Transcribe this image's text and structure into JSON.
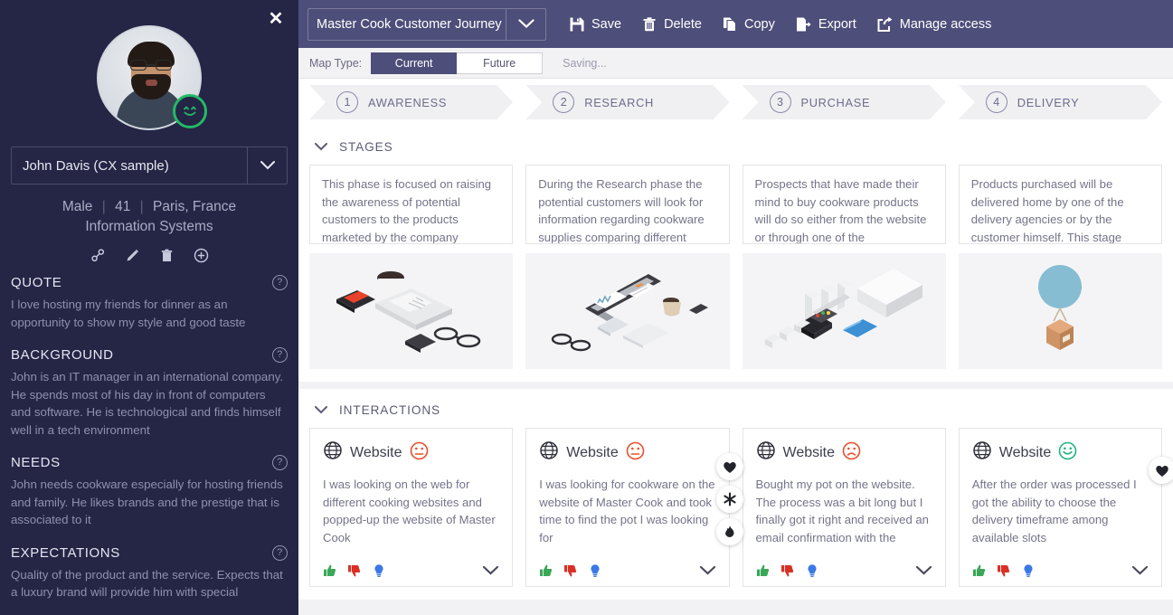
{
  "persona": {
    "close_label": "✕",
    "avatar_name": "persona-photo",
    "mood_badge": "happy-face-badge",
    "selected_persona": "John Davis (CX sample)",
    "gender": "Male",
    "age": "41",
    "location": "Paris, France",
    "role": "Information Systems",
    "separator": "|",
    "actions": [
      {
        "name": "link-icon",
        "label": "Link"
      },
      {
        "name": "edit-pencil-icon",
        "label": "Edit"
      },
      {
        "name": "trash-icon",
        "label": "Delete"
      },
      {
        "name": "plus-circle-icon",
        "label": "Add"
      }
    ],
    "help_glyph": "?",
    "sections": [
      {
        "title": "QUOTE",
        "text": "I love hosting my friends for dinner as an opportunity to show my style and good taste"
      },
      {
        "title": "BACKGROUND",
        "text": "John is an IT manager in an international company. He spends most of his day in front of computers and software. He is technological and finds himself well in a tech environment"
      },
      {
        "title": "NEEDS",
        "text": "John needs cookware especially for hosting friends and family. He likes brands and the prestige that is associated to it"
      },
      {
        "title": "EXPECTATIONS",
        "text": "Quality of the product and the service. Expects that a luxury brand will provide him with special"
      }
    ]
  },
  "topbar": {
    "map_title": "Master Cook Customer Journey (CX S...",
    "buttons": [
      {
        "name": "save-button",
        "label": "Save",
        "icon": "floppy-disk-icon"
      },
      {
        "name": "delete-button",
        "label": "Delete",
        "icon": "trash-icon"
      },
      {
        "name": "copy-button",
        "label": "Copy",
        "icon": "copy-icon"
      },
      {
        "name": "export-button",
        "label": "Export",
        "icon": "export-icon"
      },
      {
        "name": "manage-access-button",
        "label": "Manage access",
        "icon": "share-icon"
      }
    ]
  },
  "subbar": {
    "map_type_label": "Map Type:",
    "options": [
      "Current",
      "Future"
    ],
    "selected_option": "Current",
    "status": "Saving..."
  },
  "phases": [
    {
      "number": "1",
      "label": "AWARENESS"
    },
    {
      "number": "2",
      "label": "RESEARCH"
    },
    {
      "number": "3",
      "label": "PURCHASE"
    },
    {
      "number": "4",
      "label": "DELIVERY"
    }
  ],
  "stages_panel": {
    "title": "STAGES",
    "cards": [
      {
        "text": "This phase is focused on raising the awareness of potential customers to the products marketed by the company",
        "image": "newspaper-coffee-phone-illustration"
      },
      {
        "text": "During the Research phase the potential customers will look for information regarding cookware supplies comparing different",
        "image": "desktop-computer-illustration"
      },
      {
        "text": "Prospects that have made their mind to buy cookware products will do so either from the website or through one of the",
        "image": "pos-terminal-card-illustration"
      },
      {
        "text": "Products purchased will be delivered home by one of the delivery agencies or by the customer himself. This stage",
        "image": "balloon-parcel-illustration"
      }
    ]
  },
  "interactions_panel": {
    "title": "INTERACTIONS",
    "cards": [
      {
        "channel": "Website",
        "channel_icon": "globe-icon",
        "sentiment": "neutral",
        "sentiment_color": "#e8502a",
        "text": "I was looking on the web for different cooking websites and popped-up the website of Master Cook",
        "side_actions": []
      },
      {
        "channel": "Website",
        "channel_icon": "globe-icon",
        "sentiment": "neutral",
        "sentiment_color": "#e8502a",
        "text": "I was looking for cookware on the website of Master Cook and took time to find the pot I was looking for",
        "side_actions": [
          "heart-icon",
          "asterisk-icon",
          "flame-icon"
        ]
      },
      {
        "channel": "Website",
        "channel_icon": "globe-icon",
        "sentiment": "sad",
        "sentiment_color": "#e8502a",
        "text": "Bought my pot on the website. The process was a bit long but I finally got it right and received an email confirmation with the",
        "side_actions": []
      },
      {
        "channel": "Website",
        "channel_icon": "globe-icon",
        "sentiment": "happy",
        "sentiment_color": "#23b47e",
        "text": "After the order was processed I got the ability to choose the delivery timeframe among available slots",
        "side_actions": [
          "heart-icon"
        ]
      }
    ],
    "footer_icons": [
      {
        "name": "thumbs-up-icon",
        "color": "#3aa757"
      },
      {
        "name": "thumbs-down-icon",
        "color": "#d93025"
      },
      {
        "name": "lightbulb-icon",
        "color": "#3b78e7"
      }
    ]
  },
  "colors": {
    "sidebar_bg": "#252546",
    "topbar_bg": "#4e4e7a",
    "accent": "#4e4e7a",
    "page_bg": "#f2f2f4"
  }
}
